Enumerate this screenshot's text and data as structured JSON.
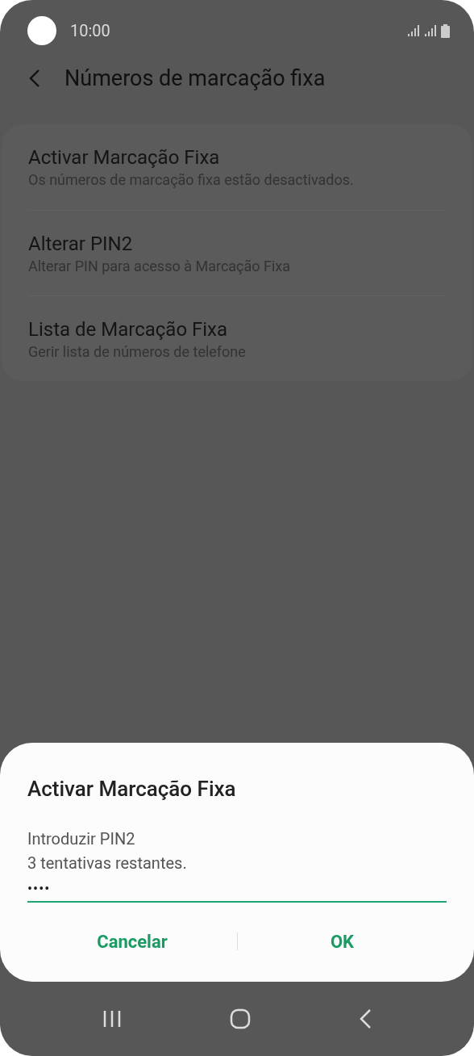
{
  "status_bar": {
    "time": "10:00"
  },
  "header": {
    "title": "Números de marcação fixa"
  },
  "settings": [
    {
      "title": "Activar Marcação Fixa",
      "subtitle": "Os números de marcação fixa estão desactivados."
    },
    {
      "title": "Alterar PIN2",
      "subtitle": "Alterar PIN para acesso à Marcação Fixa"
    },
    {
      "title": "Lista de Marcação Fixa",
      "subtitle": "Gerir lista de números de telefone"
    }
  ],
  "dialog": {
    "title": "Activar Marcação Fixa",
    "message": "Introduzir PIN2",
    "note": "3 tentativas restantes.",
    "pin_value": "••••",
    "buttons": [
      "Cancelar",
      "OK"
    ]
  }
}
